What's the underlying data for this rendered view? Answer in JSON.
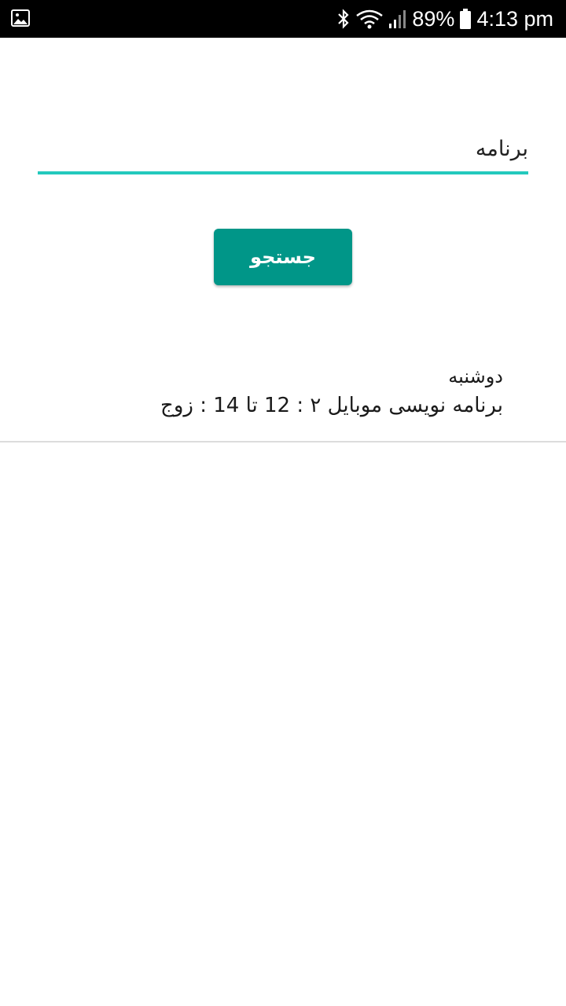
{
  "status_bar": {
    "battery": "89%",
    "time": "4:13 pm",
    "icons": [
      "gallery-icon",
      "bluetooth-icon",
      "wifi-icon",
      "signal-icon",
      "battery-icon"
    ]
  },
  "search": {
    "value": "برنامه"
  },
  "search_button": {
    "label": "جستجو"
  },
  "results": [
    {
      "day": "دوشنبه",
      "course": "برنامه نویسی موبایل ۲ : 12 تا 14 : زوج"
    }
  ],
  "colors": {
    "accent": "#23c9bd",
    "button": "#009688",
    "status_bar": "#000000"
  }
}
